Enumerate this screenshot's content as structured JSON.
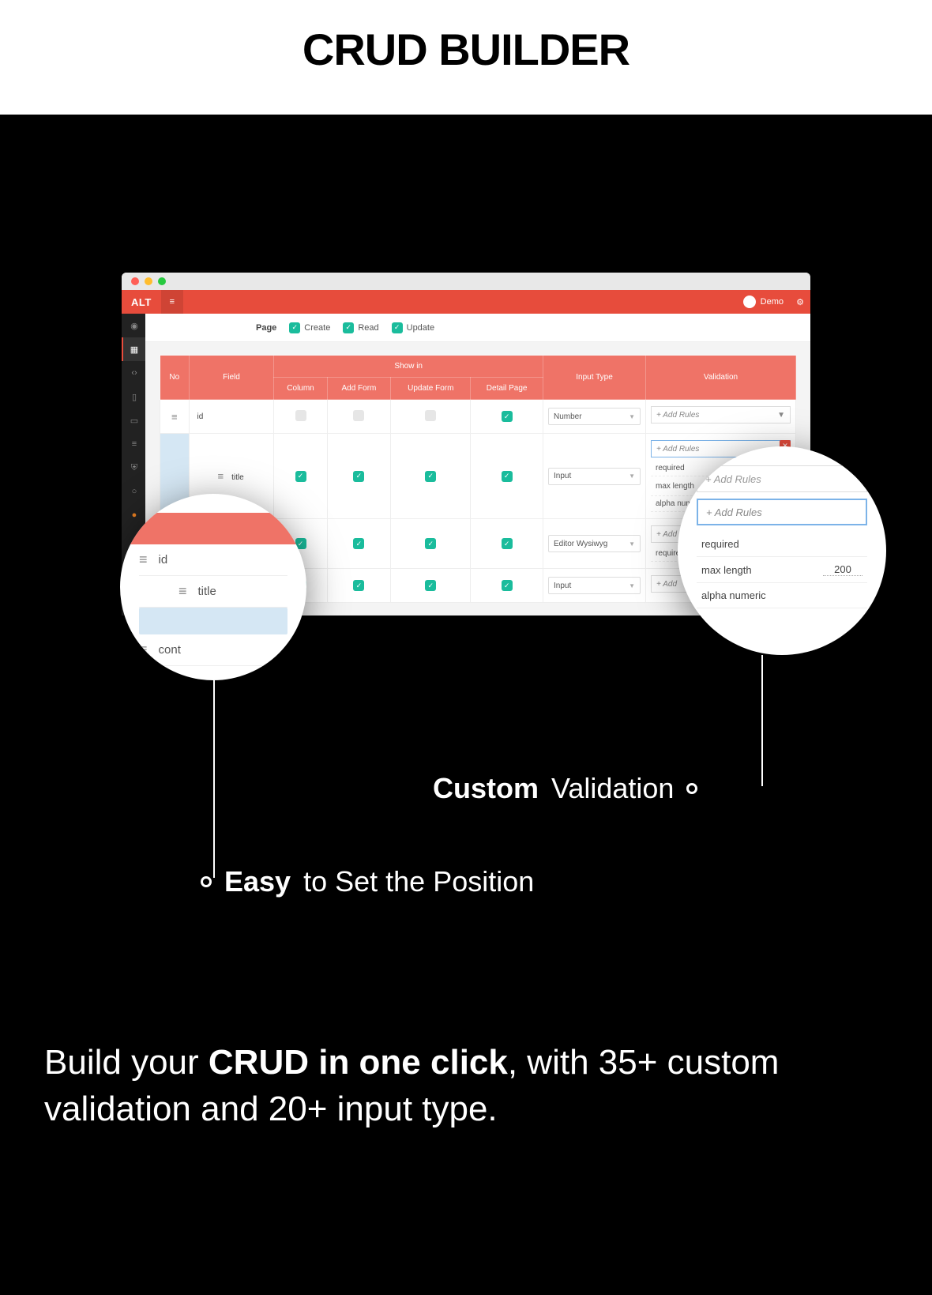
{
  "hero": {
    "title": "CRUD BUILDER"
  },
  "topbar": {
    "logo": "ALT",
    "user": "Demo"
  },
  "pageRow": {
    "label": "Page",
    "create": "Create",
    "read": "Read",
    "update": "Update"
  },
  "headers": {
    "no": "No",
    "field": "Field",
    "showin": "Show in",
    "column": "Column",
    "addform": "Add Form",
    "updateform": "Update Form",
    "detail": "Detail Page",
    "inputtype": "Input Type",
    "validation": "Validation"
  },
  "rows": [
    {
      "field": "id",
      "col": false,
      "add": false,
      "upd": false,
      "det": true,
      "input": "Number",
      "rules": {
        "add": "+ Add Rules"
      }
    },
    {
      "field": "title",
      "col": true,
      "add": true,
      "upd": true,
      "det": true,
      "input": "Input",
      "rules": {
        "add": "+ Add Rules",
        "required": "required",
        "maxlen": "max length",
        "maxlen_val": "200",
        "alphanum": "alpha numeric"
      }
    },
    {
      "field": "cont",
      "col": true,
      "add": true,
      "upd": true,
      "det": true,
      "input": "Editor Wysiwyg",
      "rules": {
        "add": "+ Add Rule",
        "required": "required"
      }
    },
    {
      "field": "",
      "col": true,
      "add": true,
      "upd": true,
      "det": true,
      "input": "Input",
      "rules": {
        "add": "+ Add"
      }
    }
  ],
  "circleLeft": {
    "id": "id",
    "title": "title",
    "cont": "cont"
  },
  "circleRight": {
    "add1": "+ Add Rules",
    "add2": "+ Add Rules",
    "required": "required",
    "maxlen": "max length",
    "maxlen_val": "200",
    "alphanum": "alpha numeric"
  },
  "captions": {
    "custom_b": "Custom",
    "custom_r": "Validation",
    "easy_b": "Easy",
    "easy_r": "to Set the Position"
  },
  "bottom": {
    "pre": "Build your ",
    "bold": "CRUD in one click",
    "post": ", with 35+ custom validation and 20+ input type."
  }
}
